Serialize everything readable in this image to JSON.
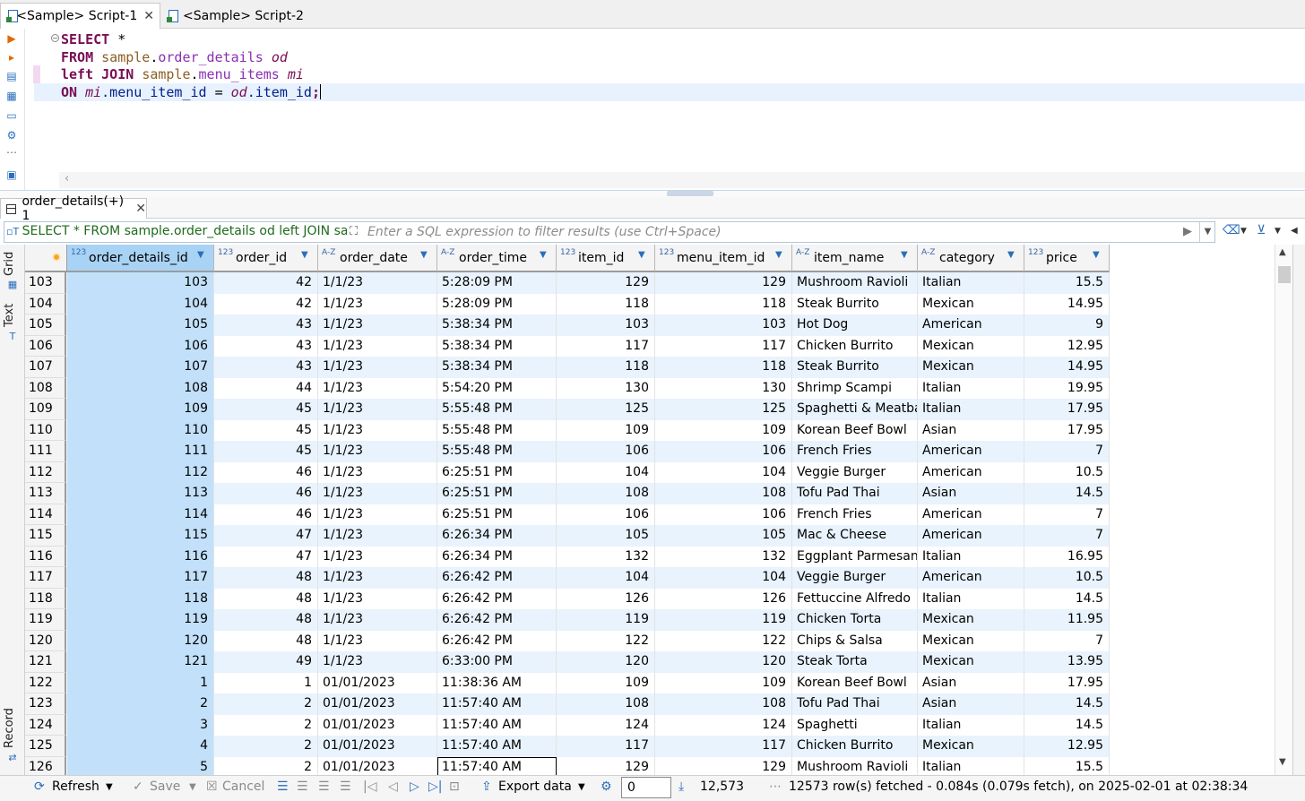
{
  "editor_tabs": [
    {
      "label": "*<Sample> Script-1",
      "active": true
    },
    {
      "label": "<Sample> Script-2",
      "active": false
    }
  ],
  "sql": {
    "line1": {
      "kw": "SELECT",
      "rest": " *"
    },
    "line2": {
      "kw": "FROM",
      "schema": "sample",
      "dot": ".",
      "table": "order_details",
      "alias": "od"
    },
    "line3": {
      "kw": "left JOIN",
      "schema": "sample",
      "dot": ".",
      "table": "menu_items",
      "alias": "mi"
    },
    "line4": {
      "kw": "ON",
      "a1": "mi",
      "c1": ".menu_item_id",
      "eq": " = ",
      "a2": "od",
      "c2": ".item_id",
      "end": ";"
    }
  },
  "results_tab": {
    "label": "order_details(+) 1"
  },
  "filter": {
    "sql_text": "SELECT * FROM sample.order_details od left JOIN samp",
    "placeholder": "Enter a SQL expression to filter results (use Ctrl+Space)"
  },
  "side_tabs": {
    "grid": "Grid",
    "text": "Text",
    "record": "Record"
  },
  "columns": [
    {
      "name": "order_details_id",
      "type": "123"
    },
    {
      "name": "order_id",
      "type": "123"
    },
    {
      "name": "order_date",
      "type": "A-Z"
    },
    {
      "name": "order_time",
      "type": "A-Z"
    },
    {
      "name": "item_id",
      "type": "123"
    },
    {
      "name": "menu_item_id",
      "type": "123"
    },
    {
      "name": "item_name",
      "type": "A-Z"
    },
    {
      "name": "category",
      "type": "A-Z"
    },
    {
      "name": "price",
      "type": "123"
    }
  ],
  "rows": [
    [
      "103",
      "103",
      "42",
      "1/1/23",
      "5:28:09 PM",
      "129",
      "129",
      "Mushroom Ravioli",
      "Italian",
      "15.5"
    ],
    [
      "104",
      "104",
      "42",
      "1/1/23",
      "5:28:09 PM",
      "118",
      "118",
      "Steak Burrito",
      "Mexican",
      "14.95"
    ],
    [
      "105",
      "105",
      "43",
      "1/1/23",
      "5:38:34 PM",
      "103",
      "103",
      "Hot Dog",
      "American",
      "9"
    ],
    [
      "106",
      "106",
      "43",
      "1/1/23",
      "5:38:34 PM",
      "117",
      "117",
      "Chicken Burrito",
      "Mexican",
      "12.95"
    ],
    [
      "107",
      "107",
      "43",
      "1/1/23",
      "5:38:34 PM",
      "118",
      "118",
      "Steak Burrito",
      "Mexican",
      "14.95"
    ],
    [
      "108",
      "108",
      "44",
      "1/1/23",
      "5:54:20 PM",
      "130",
      "130",
      "Shrimp Scampi",
      "Italian",
      "19.95"
    ],
    [
      "109",
      "109",
      "45",
      "1/1/23",
      "5:55:48 PM",
      "125",
      "125",
      "Spaghetti & Meatbal",
      "Italian",
      "17.95"
    ],
    [
      "110",
      "110",
      "45",
      "1/1/23",
      "5:55:48 PM",
      "109",
      "109",
      "Korean Beef Bowl",
      "Asian",
      "17.95"
    ],
    [
      "111",
      "111",
      "45",
      "1/1/23",
      "5:55:48 PM",
      "106",
      "106",
      "French Fries",
      "American",
      "7"
    ],
    [
      "112",
      "112",
      "46",
      "1/1/23",
      "6:25:51 PM",
      "104",
      "104",
      "Veggie Burger",
      "American",
      "10.5"
    ],
    [
      "113",
      "113",
      "46",
      "1/1/23",
      "6:25:51 PM",
      "108",
      "108",
      "Tofu Pad Thai",
      "Asian",
      "14.5"
    ],
    [
      "114",
      "114",
      "46",
      "1/1/23",
      "6:25:51 PM",
      "106",
      "106",
      "French Fries",
      "American",
      "7"
    ],
    [
      "115",
      "115",
      "47",
      "1/1/23",
      "6:26:34 PM",
      "105",
      "105",
      "Mac & Cheese",
      "American",
      "7"
    ],
    [
      "116",
      "116",
      "47",
      "1/1/23",
      "6:26:34 PM",
      "132",
      "132",
      "Eggplant Parmesan",
      "Italian",
      "16.95"
    ],
    [
      "117",
      "117",
      "48",
      "1/1/23",
      "6:26:42 PM",
      "104",
      "104",
      "Veggie Burger",
      "American",
      "10.5"
    ],
    [
      "118",
      "118",
      "48",
      "1/1/23",
      "6:26:42 PM",
      "126",
      "126",
      "Fettuccine Alfredo",
      "Italian",
      "14.5"
    ],
    [
      "119",
      "119",
      "48",
      "1/1/23",
      "6:26:42 PM",
      "119",
      "119",
      "Chicken Torta",
      "Mexican",
      "11.95"
    ],
    [
      "120",
      "120",
      "48",
      "1/1/23",
      "6:26:42 PM",
      "122",
      "122",
      "Chips & Salsa",
      "Mexican",
      "7"
    ],
    [
      "121",
      "121",
      "49",
      "1/1/23",
      "6:33:00 PM",
      "120",
      "120",
      "Steak Torta",
      "Mexican",
      "13.95"
    ],
    [
      "122",
      "1",
      "1",
      "01/01/2023",
      "11:38:36 AM",
      "109",
      "109",
      "Korean Beef Bowl",
      "Asian",
      "17.95"
    ],
    [
      "123",
      "2",
      "2",
      "01/01/2023",
      "11:57:40 AM",
      "108",
      "108",
      "Tofu Pad Thai",
      "Asian",
      "14.5"
    ],
    [
      "124",
      "3",
      "2",
      "01/01/2023",
      "11:57:40 AM",
      "124",
      "124",
      "Spaghetti",
      "Italian",
      "14.5"
    ],
    [
      "125",
      "4",
      "2",
      "01/01/2023",
      "11:57:40 AM",
      "117",
      "117",
      "Chicken Burrito",
      "Mexican",
      "12.95"
    ],
    [
      "126",
      "5",
      "2",
      "01/01/2023",
      "11:57:40 AM",
      "129",
      "129",
      "Mushroom Ravioli",
      "Italian",
      "15.5"
    ]
  ],
  "bottom_bar": {
    "refresh": "Refresh",
    "save": "Save",
    "cancel": "Cancel",
    "export": "Export data",
    "fetch_size": "0",
    "row_count": "12,573",
    "status": "12573 row(s) fetched - 0.084s (0.079s fetch), on 2025-02-01 at 02:38:34"
  }
}
